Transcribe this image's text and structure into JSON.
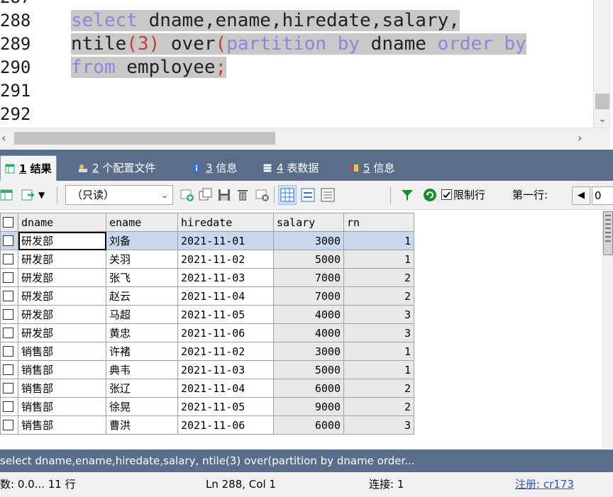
{
  "editor": {
    "top_partial_line_number": "287",
    "line_numbers": [
      "288",
      "289",
      "290",
      "291",
      "292"
    ],
    "lines": [
      {
        "parts": [
          [
            "kw",
            "select"
          ],
          [
            "id",
            " dname"
          ],
          [
            "pn",
            ","
          ],
          [
            "id",
            "ename"
          ],
          [
            "pn",
            ","
          ],
          [
            "id",
            "hiredate"
          ],
          [
            "pn",
            ","
          ],
          [
            "id",
            "salary"
          ],
          [
            "pn",
            ","
          ]
        ]
      },
      {
        "parts": [
          [
            "id",
            "ntile"
          ],
          [
            "paren",
            "("
          ],
          [
            "num",
            "3"
          ],
          [
            "paren",
            ")"
          ],
          [
            "id",
            " over"
          ],
          [
            "paren",
            "("
          ],
          [
            "kw",
            "partition by"
          ],
          [
            "id",
            " dname "
          ],
          [
            "kw",
            "order by"
          ]
        ]
      },
      {
        "parts": [
          [
            "kw",
            "from"
          ],
          [
            "id",
            " employee"
          ],
          [
            "semi",
            ";"
          ]
        ]
      }
    ]
  },
  "tabs": [
    {
      "num": "1",
      "label": "结果",
      "active": true,
      "icon": "grid-result-icon"
    },
    {
      "num": "2",
      "label": "个配置文件",
      "active": false,
      "icon": "profile-icon"
    },
    {
      "num": "3",
      "label": "信息",
      "active": false,
      "icon": "info-icon"
    },
    {
      "num": "4",
      "label": "表数据",
      "active": false,
      "icon": "table-data-icon"
    },
    {
      "num": "5",
      "label": "信息",
      "active": false,
      "icon": "info2-icon"
    }
  ],
  "toolbar": {
    "mode": "（只读）",
    "limit_label": "限制行",
    "first_row_label": "第一行:",
    "first_row_value": "0"
  },
  "grid": {
    "columns": [
      "dname",
      "ename",
      "hiredate",
      "salary",
      "rn"
    ],
    "rows": [
      [
        "研发部",
        "刘备",
        "2021-11-01",
        "3000",
        "1"
      ],
      [
        "研发部",
        "关羽",
        "2021-11-02",
        "5000",
        "1"
      ],
      [
        "研发部",
        "张飞",
        "2021-11-03",
        "7000",
        "2"
      ],
      [
        "研发部",
        "赵云",
        "2021-11-04",
        "7000",
        "2"
      ],
      [
        "研发部",
        "马超",
        "2021-11-05",
        "4000",
        "3"
      ],
      [
        "研发部",
        "黄忠",
        "2021-11-06",
        "4000",
        "3"
      ],
      [
        "销售部",
        "许褚",
        "2021-11-02",
        "3000",
        "1"
      ],
      [
        "销售部",
        "典韦",
        "2021-11-03",
        "5000",
        "1"
      ],
      [
        "销售部",
        "张辽",
        "2021-11-04",
        "6000",
        "2"
      ],
      [
        "销售部",
        "徐晃",
        "2021-11-05",
        "9000",
        "2"
      ],
      [
        "销售部",
        "曹洪",
        "2021-11-06",
        "6000",
        "3"
      ]
    ]
  },
  "sql_preview": "select dname,ename,hiredate,salary, ntile(3) over(partition by dname order...",
  "status": {
    "left": "数: 0.0... 11 行",
    "position": "Ln 288, Col 1",
    "connection": "连接: 1",
    "register": "注册:  cr173"
  }
}
